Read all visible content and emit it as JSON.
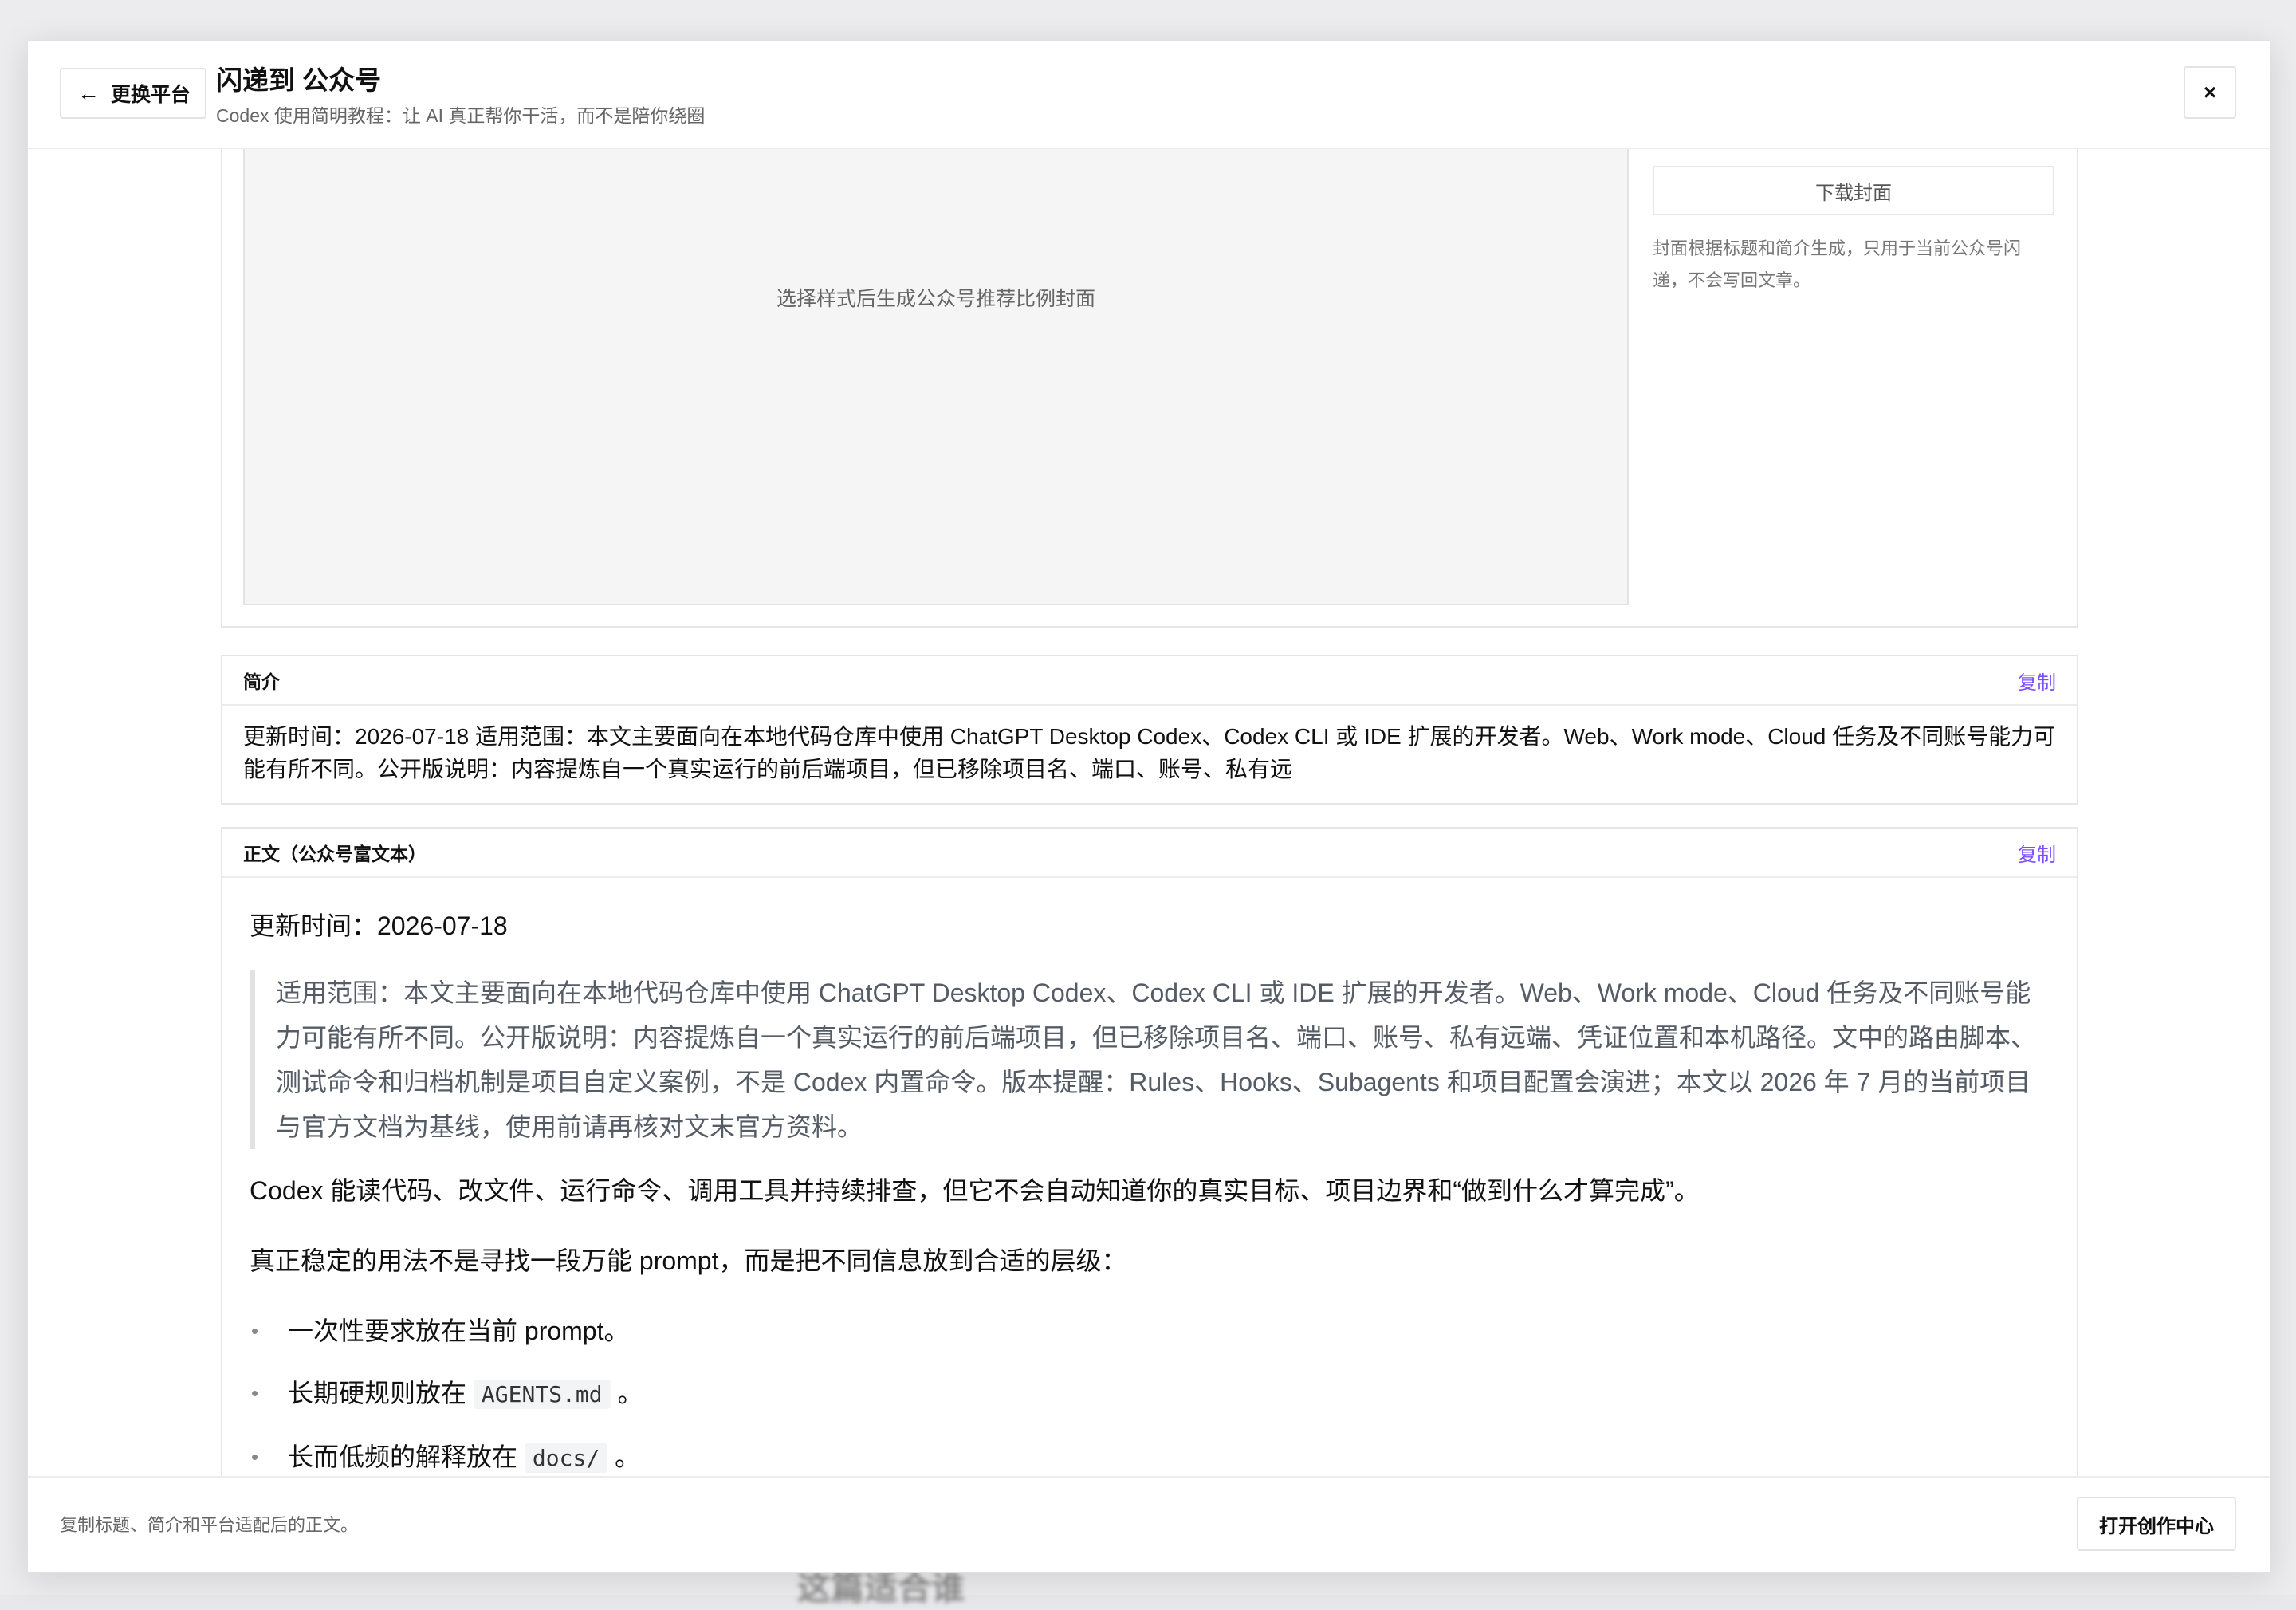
{
  "background": {
    "hint_text": "这篇适合谁"
  },
  "header": {
    "back_label": "更换平台",
    "back_arrow": "←",
    "title": "闪递到 公众号",
    "subtitle": "Codex 使用简明教程：让 AI 真正帮你干活，而不是陪你绕圈",
    "close_symbol": "×"
  },
  "cover": {
    "placeholder": "选择样式后生成公众号推荐比例封面",
    "download_label": "下载封面",
    "note": "封面根据标题和简介生成，只用于当前公众号闪递，不会写回文章。"
  },
  "summary": {
    "label": "简介",
    "copy_label": "复制",
    "text": "更新时间：2026-07-18 适用范围：本文主要面向在本地代码仓库中使用 ChatGPT Desktop Codex、Codex CLI 或 IDE 扩展的开发者。Web、Work mode、Cloud 任务及不同账号能力可能有所不同。公开版说明：内容提炼自一个真实运行的前后端项目，但已移除项目名、端口、账号、私有远"
  },
  "body": {
    "label": "正文（公众号富文本）",
    "copy_label": "复制",
    "updated": "更新时间：2026-07-18",
    "quote": "适用范围：本文主要面向在本地代码仓库中使用 ChatGPT Desktop Codex、Codex CLI 或 IDE 扩展的开发者。Web、Work mode、Cloud 任务及不同账号能力可能有所不同。公开版说明：内容提炼自一个真实运行的前后端项目，但已移除项目名、端口、账号、私有远端、凭证位置和本机路径。文中的路由脚本、测试命令和归档机制是项目自定义案例，不是 Codex 内置命令。版本提醒：Rules、Hooks、Subagents 和项目配置会演进；本文以 2026 年 7 月的当前项目与官方文档为基线，使用前请再核对文末官方资料。",
    "para1": "Codex 能读代码、改文件、运行命令、调用工具并持续排查，但它不会自动知道你的真实目标、项目边界和“做到什么才算完成”。",
    "para2": "真正稳定的用法不是寻找一段万能 prompt，而是把不同信息放到合适的层级：",
    "list": [
      {
        "bullet": "•",
        "text": "一次性要求放在当前 prompt。",
        "code": "",
        "tail": ""
      },
      {
        "bullet": "•",
        "text": "长期硬规则放在",
        "code": "AGENTS.md",
        "tail": "。"
      },
      {
        "bullet": "•",
        "text": "长而低频的解释放在",
        "code": "docs/",
        "tail": "。"
      }
    ]
  },
  "footer": {
    "note": "复制标题、简介和平台适配后的正文。",
    "open_label": "打开创作中心"
  }
}
